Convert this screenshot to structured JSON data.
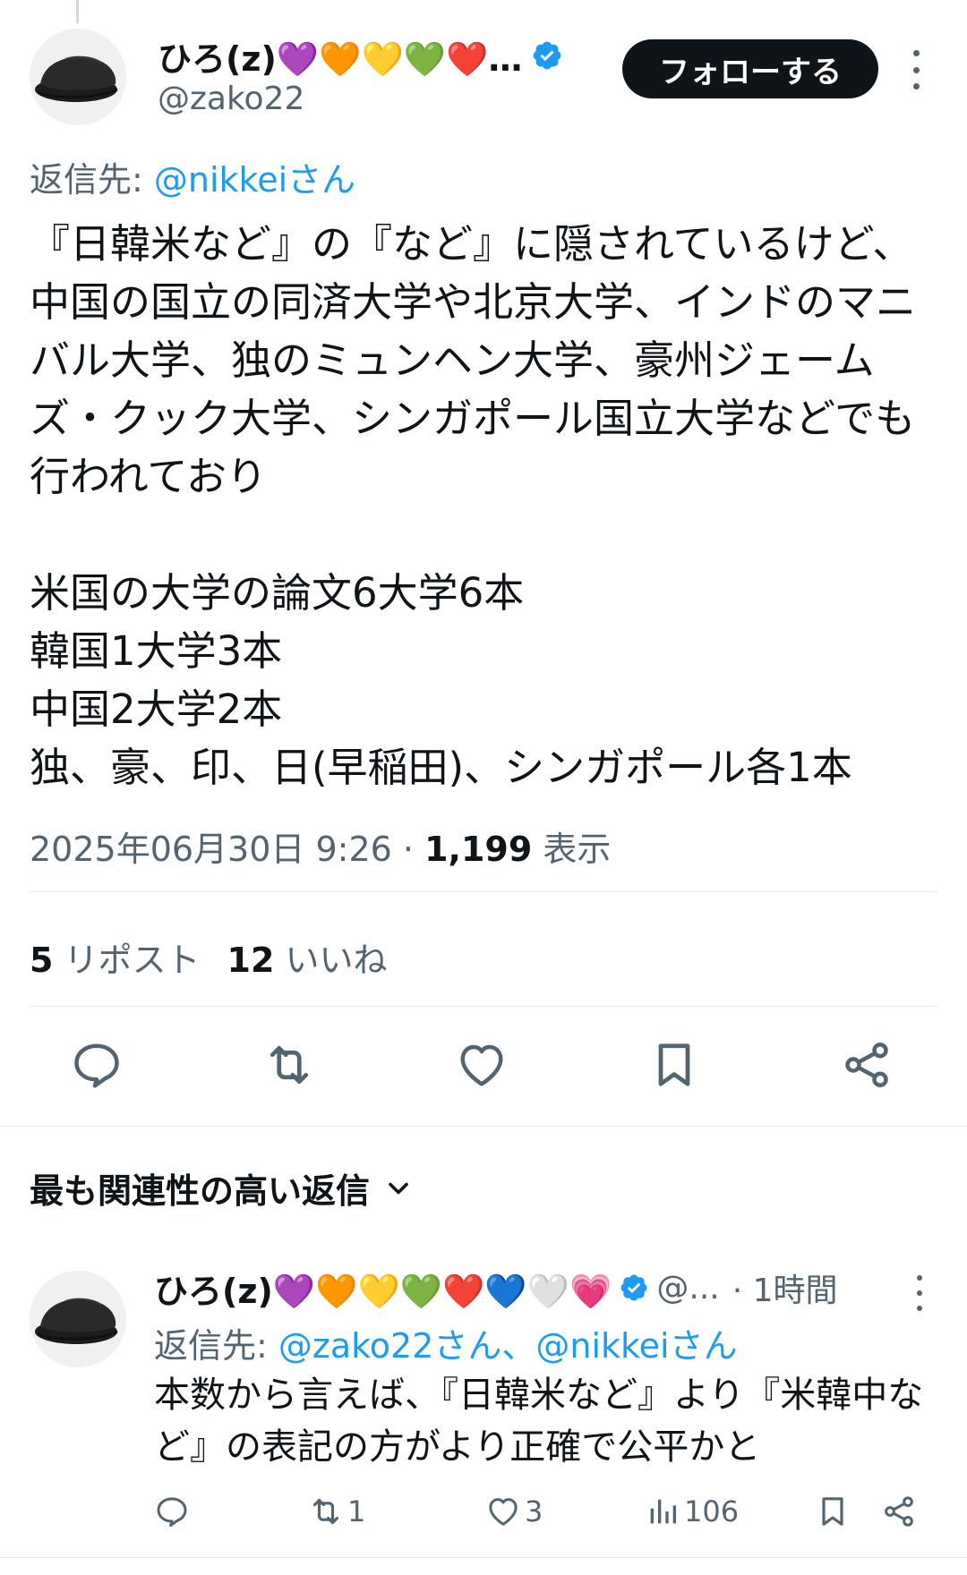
{
  "post": {
    "author": {
      "display_name": "ひろ(z)💜🧡💛💚❤️…",
      "handle": "@zako22",
      "verified": true
    },
    "follow_label": "フォローする",
    "reply_to_prefix": "返信先: ",
    "reply_to_mention": "@nikkeiさん",
    "text": "『日韓米など』の『など』に隠されているけど、中国の国立の同済大学や北京大学、インドのマニバル大学、独のミュンヘン大学、豪州ジェームズ・クック大学、シンガポール国立大学などでも行われており\n\n米国の大学の論文6大学6本\n韓国1大学3本\n中国2大学2本\n独、豪、印、日(早稲田)、シンガポール各1本",
    "timestamp": "2025年06月30日 9:26",
    "separator": " · ",
    "views_count": "1,199",
    "views_label": " 表示",
    "reposts_count": "5",
    "reposts_label": " リポスト",
    "likes_count": "12",
    "likes_label": " いいね"
  },
  "replies_section": {
    "sort_label": "最も関連性の高い返信"
  },
  "reply": {
    "display_name": "ひろ(z)💜🧡💛💚❤️💙🤍💗",
    "handle": "@...",
    "time": "· 1時間",
    "reply_to_prefix": "返信先: ",
    "reply_to_mentions": "@zako22さん、@nikkeiさん",
    "text": "本数から言えば、『日韓米など』より『米韓中など』の表記の方がより正確で公平かと",
    "reposts": "1",
    "likes": "3",
    "views": "106"
  },
  "colors": {
    "accent": "#1d9bf0",
    "text_primary": "#0f1419",
    "text_secondary": "#536471",
    "divider": "#e1e8ed",
    "follow_bg": "#0f1419"
  },
  "icons": [
    "avatar-hat",
    "verified-badge-icon",
    "more-icon",
    "reply-icon",
    "repost-icon",
    "like-icon",
    "bookmark-icon",
    "share-icon",
    "chevron-down-icon",
    "views-icon"
  ]
}
